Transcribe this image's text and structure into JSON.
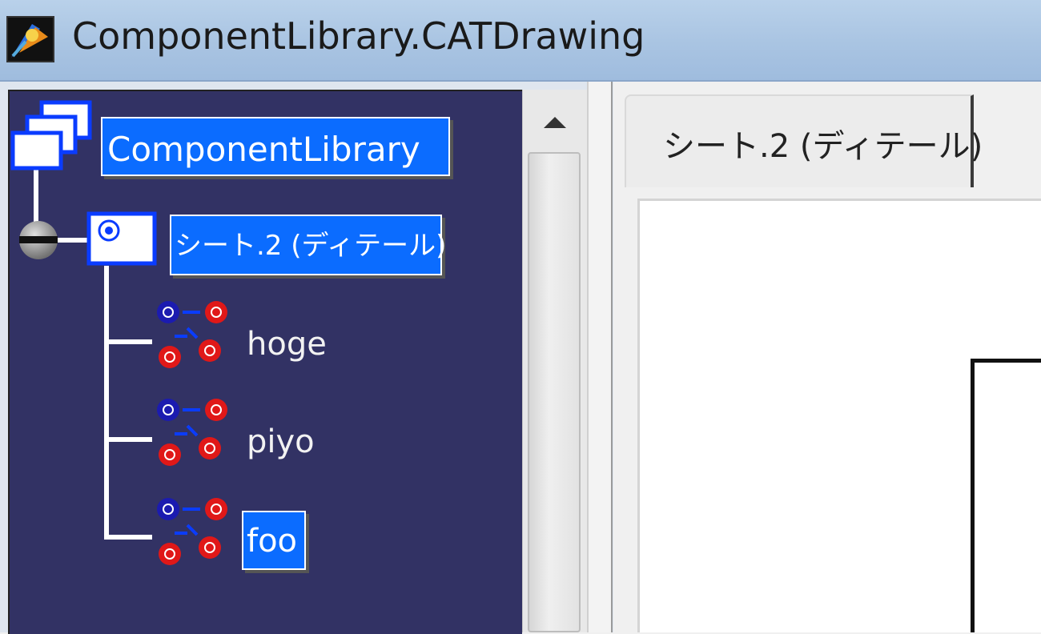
{
  "window": {
    "title": "ComponentLibrary.CATDrawing",
    "app_icon": "catia-icon"
  },
  "tree": {
    "background": "#323264",
    "root": {
      "label": "ComponentLibrary",
      "icon": "documents-icon",
      "selected": true
    },
    "sheet": {
      "label": "シート.2 (ディテール)",
      "icon": "sheet-icon",
      "selected": true,
      "expander": "minus-node-icon"
    },
    "views": [
      {
        "label": "hoge",
        "icon": "detail-view-icon",
        "selected": false
      },
      {
        "label": "piyo",
        "icon": "detail-view-icon",
        "selected": false
      },
      {
        "label": "foo",
        "icon": "detail-view-icon",
        "selected": true
      }
    ]
  },
  "scrollbar": {
    "up_arrow": "scroll-up-arrow-icon"
  },
  "tabs": [
    {
      "label": "シート.2 (ディテール)",
      "active": true
    }
  ],
  "colors": {
    "selection": "#0b6cff",
    "title_bar": "#b9d1ea"
  }
}
